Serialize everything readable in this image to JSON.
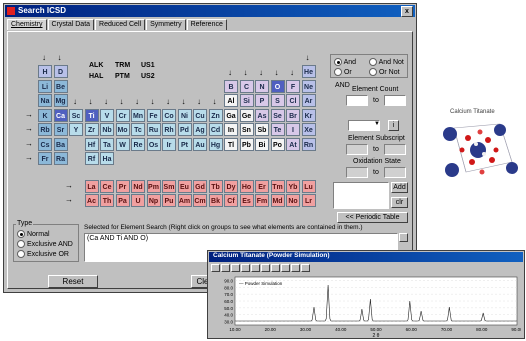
{
  "window": {
    "title": "Search ICSD",
    "close_label": "x"
  },
  "tabs": [
    "Chemistry",
    "Crystal Data",
    "Reduced Cell",
    "Symmetry",
    "Reference"
  ],
  "groups_box": [
    "ALK",
    "TRM",
    "US1",
    "HAL",
    "PTM",
    "US2"
  ],
  "periodic_rows": [
    [
      "H",
      "D"
    ],
    [
      "Li",
      "Be",
      "B",
      "C",
      "N",
      "O",
      "F",
      "Ne"
    ],
    [
      "Na",
      "Mg",
      "Al",
      "Si",
      "P",
      "S",
      "Cl",
      "Ar"
    ],
    [
      "K",
      "Ca",
      "Sc",
      "Ti",
      "V",
      "Cr",
      "Mn",
      "Fe",
      "Co",
      "Ni",
      "Cu",
      "Zn",
      "Ga",
      "Ge",
      "As",
      "Se",
      "Br",
      "Kr"
    ],
    [
      "Rb",
      "Sr",
      "Y",
      "Zr",
      "Nb",
      "Mo",
      "Tc",
      "Ru",
      "Rh",
      "Pd",
      "Ag",
      "Cd",
      "In",
      "Sn",
      "Sb",
      "Te",
      "I",
      "Xe"
    ],
    [
      "Cs",
      "Ba",
      "Hf",
      "Ta",
      "W",
      "Re",
      "Os",
      "Ir",
      "Pt",
      "Au",
      "Hg",
      "Tl",
      "Pb",
      "Bi",
      "Po",
      "At",
      "Rn"
    ],
    [
      "Fr",
      "Ra",
      "Rf",
      "Ha"
    ],
    [
      "La",
      "Ce",
      "Pr",
      "Nd",
      "Pm",
      "Sm",
      "Eu",
      "Gd",
      "Tb",
      "Dy",
      "Ho",
      "Er",
      "Tm",
      "Yb",
      "Lu"
    ],
    [
      "Ac",
      "Th",
      "Pa",
      "U",
      "Np",
      "Pu",
      "Am",
      "Cm",
      "Bk",
      "Cf",
      "Es",
      "Fm",
      "Md",
      "No",
      "Lr"
    ]
  ],
  "side_panel": {
    "logic_options": [
      "And",
      "Or",
      "And Not",
      "Or Not"
    ],
    "and_label": "AND",
    "element_count_label": "Element Count",
    "to_label": "to",
    "element_subscript_label": "Element Subscript",
    "oxidation_state_label": "Oxidation State",
    "add_label": "Add",
    "clr_label": "clr",
    "periodic_table_button": "<< Periodic Table",
    "select_info_icon": "i"
  },
  "type_box": {
    "label": "Type",
    "options": [
      "Normal",
      "Exclusive AND",
      "Exclusive OR"
    ]
  },
  "selection": {
    "label": "Selected for Element Search (Right click on groups to see what elements are contained in them.)",
    "value": "(Ca AND Ti AND O)"
  },
  "buttons": {
    "reset": "Reset",
    "clear": "Clear"
  },
  "crystal": {
    "title": "Calcium Titanate"
  },
  "spectrum": {
    "title": "Calcium Titanate (Powder Simulation)",
    "legend": "Powder Simulation",
    "x_label": "2 θ",
    "x_ticks": [
      "10.00",
      "20.00",
      "30.00",
      "40.00",
      "50.00",
      "60.00",
      "70.00",
      "80.00",
      "90.00"
    ],
    "y_ticks": [
      "90.0",
      "80.0",
      "70.0",
      "60.0",
      "50.0",
      "40.0",
      "30.0"
    ],
    "toolbar_icons": [
      "print-icon",
      "zoom-in-icon",
      "zoom-out-icon",
      "first-icon",
      "prev-icon",
      "next-icon",
      "last-icon",
      "grid-icon",
      "cursor-icon",
      "axis-icon"
    ]
  },
  "colors": {
    "titlebar": "#00207e",
    "selected_element": "#5060c0",
    "lanthanide": "#f0a0a0"
  }
}
